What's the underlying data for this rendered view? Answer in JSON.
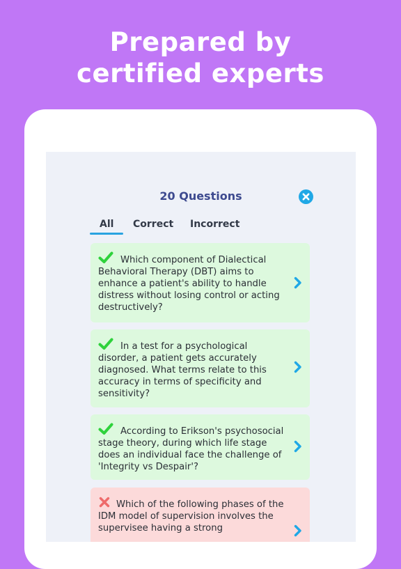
{
  "headline": {
    "line1": "Prepared by",
    "line2": "certified experts"
  },
  "screen": {
    "title": "20 Questions",
    "close_icon": "close-circle-icon",
    "tabs": [
      {
        "label": "All",
        "selected": true
      },
      {
        "label": "Correct",
        "selected": false
      },
      {
        "label": "Incorrect",
        "selected": false
      }
    ],
    "questions": [
      {
        "status": "correct",
        "icon": "checkmark-icon",
        "text": "Which component of Dialectical Behavioral Therapy (DBT) aims to enhance a patient's ability to handle distress without losing control or acting destructively?"
      },
      {
        "status": "correct",
        "icon": "checkmark-icon",
        "text": "In a test for a psychological disorder, a patient gets accurately diagnosed. What terms relate to this accuracy in terms of specificity and sensitivity?"
      },
      {
        "status": "correct",
        "icon": "checkmark-icon",
        "text": "According to Erikson's psychosocial stage theory, during which life stage does an individual face the challenge of 'Integrity vs Despair'?"
      },
      {
        "status": "incorrect",
        "icon": "cross-icon",
        "text": "Which of the following phases of the IDM model of supervision involves the supervisee having a strong"
      }
    ]
  },
  "colors": {
    "background": "#c077f6",
    "accent": "#20a8e6",
    "title": "#3d4a8f",
    "correct_card": "#ddf9de",
    "incorrect_card": "#fcdada",
    "check": "#2fd23c",
    "cross": "#ee6b6b"
  }
}
